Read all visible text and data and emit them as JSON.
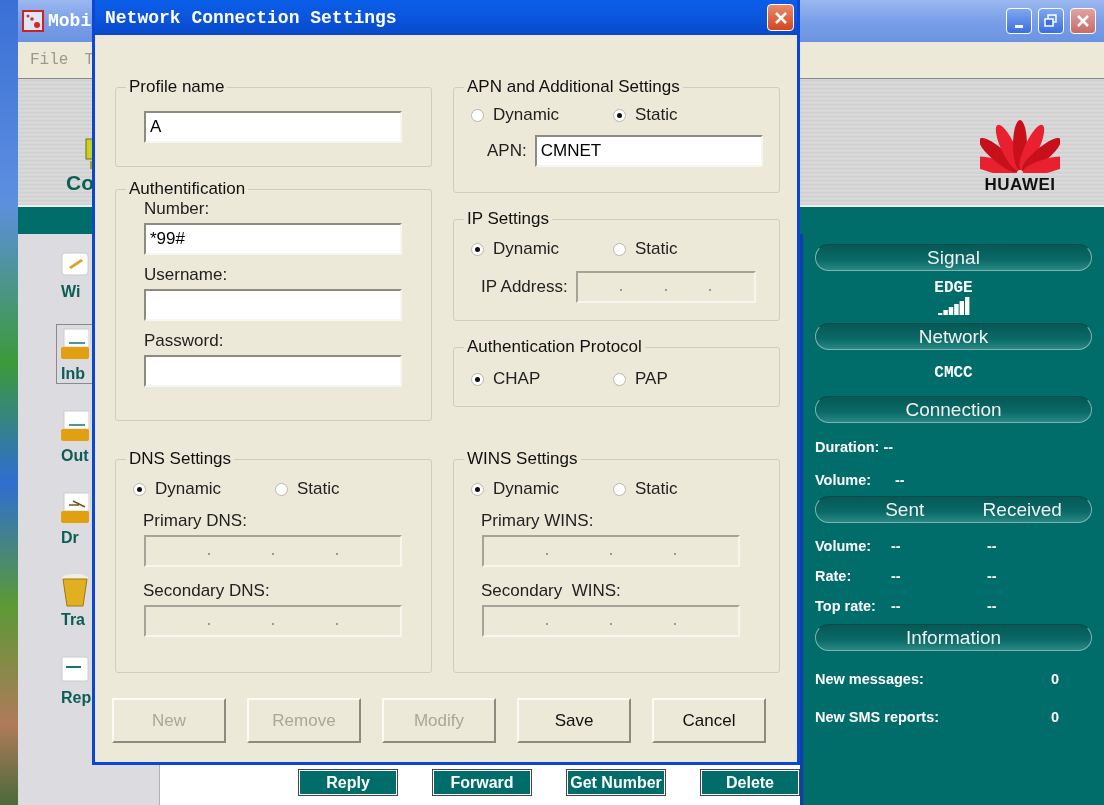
{
  "main_window": {
    "title": "Mobi",
    "menu": [
      "File",
      "T"
    ],
    "banner": {
      "toolbar_label": "Co",
      "logo_text": "HUAWEI"
    },
    "sidebar": [
      {
        "label": "Wi",
        "kind": "compose",
        "selected": false
      },
      {
        "label": "Inb",
        "kind": "tray",
        "selected": true
      },
      {
        "label": "Out",
        "kind": "tray",
        "selected": false
      },
      {
        "label": "Dr",
        "kind": "draft",
        "selected": false
      },
      {
        "label": "Tra",
        "kind": "trash",
        "selected": false
      },
      {
        "label": "Rep",
        "kind": "report",
        "selected": false
      }
    ],
    "message_actions": [
      "Reply",
      "Forward",
      "Get Number",
      "Delete"
    ],
    "status_panel": {
      "signal": {
        "header": "Signal",
        "network_type": "EDGE"
      },
      "network": {
        "header": "Network",
        "operator": "CMCC"
      },
      "connection": {
        "header": "Connection",
        "duration": {
          "label": "Duration:",
          "value": "--"
        },
        "volume": {
          "label": "Volume:",
          "value": "--"
        },
        "columns": [
          "Sent",
          "Received"
        ],
        "traffic_rows": [
          {
            "label": "Volume:",
            "sent": "--",
            "received": "--"
          },
          {
            "label": "Rate:",
            "sent": "--",
            "received": "--"
          },
          {
            "label": "Top rate:",
            "sent": "--",
            "received": "--"
          }
        ]
      },
      "information": {
        "header": "Information",
        "rows": [
          {
            "label": "New messages:",
            "value": "0"
          },
          {
            "label": "New SMS reports:",
            "value": "0"
          }
        ]
      }
    }
  },
  "dialog": {
    "title": "Network Connection Settings",
    "profile": {
      "legend": "Profile name",
      "value": "A"
    },
    "authentification": {
      "legend": "Authentification",
      "fields": [
        {
          "label": "Number:",
          "value": "*99#"
        },
        {
          "label": "Username:"
        },
        {
          "label": "Password:"
        }
      ]
    },
    "apn": {
      "legend": "APN and Additional Settings",
      "options": [
        {
          "label": "Dynamic",
          "selected": false
        },
        {
          "label": "Static",
          "selected": true
        }
      ],
      "field_label": "APN:",
      "value": "CMNET"
    },
    "ip": {
      "legend": "IP Settings",
      "options": [
        {
          "label": "Dynamic",
          "selected": true
        },
        {
          "label": "Static",
          "selected": false
        }
      ],
      "field_label": "IP Address:",
      "disabled": true
    },
    "auth_protocol": {
      "legend": "Authentication Protocol",
      "options": [
        {
          "label": "CHAP",
          "selected": true
        },
        {
          "label": "PAP",
          "selected": false
        }
      ]
    },
    "dns": {
      "legend": "DNS Settings",
      "options": [
        {
          "label": "Dynamic",
          "selected": true
        },
        {
          "label": "Static",
          "selected": false
        }
      ],
      "fields": [
        {
          "label": "Primary DNS:",
          "disabled": true
        },
        {
          "label": "Secondary DNS:",
          "disabled": true
        }
      ]
    },
    "wins": {
      "legend": "WINS Settings",
      "options": [
        {
          "label": "Dynamic",
          "selected": true
        },
        {
          "label": "Static",
          "selected": false
        }
      ],
      "fields": [
        {
          "label": "Primary WINS:",
          "disabled": true
        },
        {
          "label": "Secondary  WINS:",
          "disabled": true
        }
      ]
    },
    "buttons": [
      {
        "label": "New",
        "disabled": true
      },
      {
        "label": "Remove",
        "disabled": true
      },
      {
        "label": "Modify",
        "disabled": true
      },
      {
        "label": "Save",
        "disabled": false
      },
      {
        "label": "Cancel",
        "disabled": false
      }
    ]
  }
}
